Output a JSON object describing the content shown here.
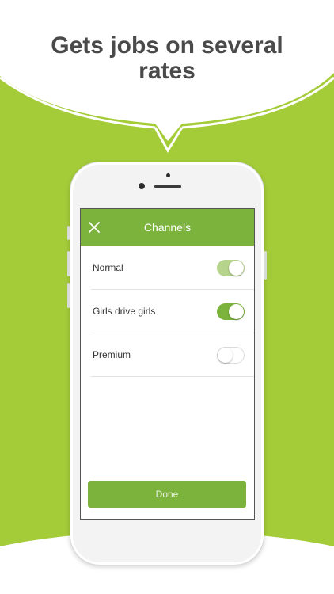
{
  "headline": {
    "line1": "Gets jobs on several",
    "line2": "rates"
  },
  "colors": {
    "brand_green": "#a4cc39",
    "nav_green": "#7cb33d",
    "text_dark": "#4a4a4a"
  },
  "screen": {
    "title": "Channels",
    "close_icon": "close-icon",
    "channels": [
      {
        "label": "Normal",
        "enabled": true,
        "state": "on-disabled"
      },
      {
        "label": "Girls drive girls",
        "enabled": true,
        "state": "on"
      },
      {
        "label": "Premium",
        "enabled": false,
        "state": "off"
      }
    ],
    "done_label": "Done"
  }
}
